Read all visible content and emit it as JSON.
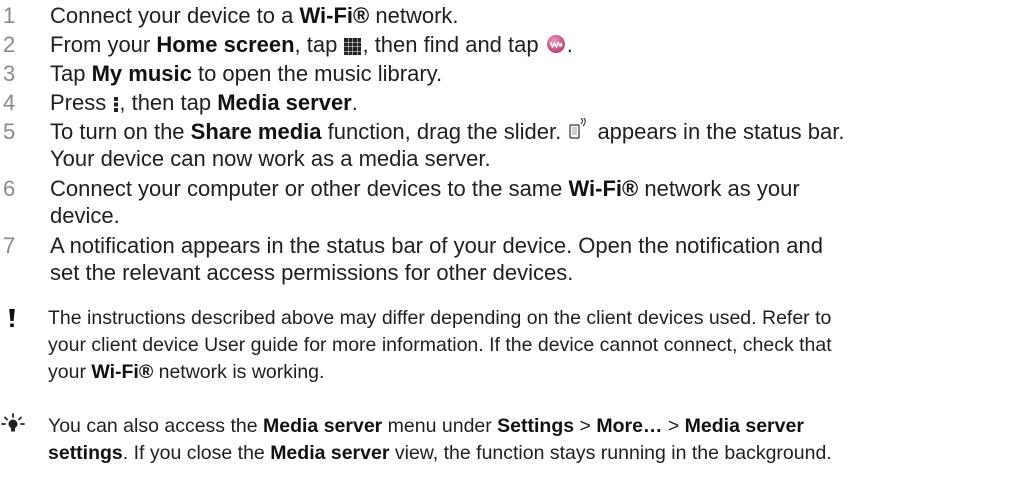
{
  "steps": [
    {
      "number": "1",
      "text_a": "Connect your device to a ",
      "bold_a": "Wi-Fi®",
      "text_b": " network."
    },
    {
      "number": "2",
      "text_a": "From your ",
      "bold_a": "Home screen",
      "text_b": ", tap ",
      "text_c": ", then find and tap ",
      "text_d": "."
    },
    {
      "number": "3",
      "text_a": "Tap ",
      "bold_a": "My music",
      "text_b": " to open the music library."
    },
    {
      "number": "4",
      "text_a": "Press ",
      "text_b": ", then tap ",
      "bold_a": "Media server",
      "text_c": "."
    },
    {
      "number": "5",
      "text_a": "To turn on the ",
      "bold_a": "Share media",
      "text_b": " function, drag the slider. ",
      "text_c": " appears in the status bar.",
      "line2": "Your device can now work as a media server."
    },
    {
      "number": "6",
      "text_a": "Connect your computer or other devices to the same ",
      "bold_a": "Wi-Fi®",
      "text_b": " network as your",
      "line2": "device."
    },
    {
      "number": "7",
      "line1": "A notification appears in the status bar of your device. Open the notification and",
      "line2": "set the relevant access permissions for other devices."
    }
  ],
  "note": {
    "icon": "exclamation-icon",
    "line1": "The instructions described above may differ depending on the client devices used. Refer to",
    "line2": "your client device User guide for more information. If the device cannot connect, check that",
    "line3_a": "your ",
    "line3_bold": "Wi-Fi®",
    "line3_b": " network is working."
  },
  "tip": {
    "icon": "lightbulb-icon",
    "a": "You can also access the ",
    "b": "Media server",
    "c": " menu under ",
    "d": "Settings",
    "e": " > ",
    "f": "More…",
    "g": " > ",
    "h": "Media server",
    "i": "settings",
    "j": ". If you close the ",
    "k": "Media server",
    "l": " view, the function stays running in the background."
  },
  "icons": {
    "apps": "apps-grid-icon",
    "walkman": "walkman-app-icon",
    "menu": "menu-dots-icon",
    "share": "media-share-status-icon"
  },
  "colors": {
    "step_number": "#8a8a8a",
    "text": "#1f1f1f",
    "walkman_icon": "#c2477a"
  }
}
